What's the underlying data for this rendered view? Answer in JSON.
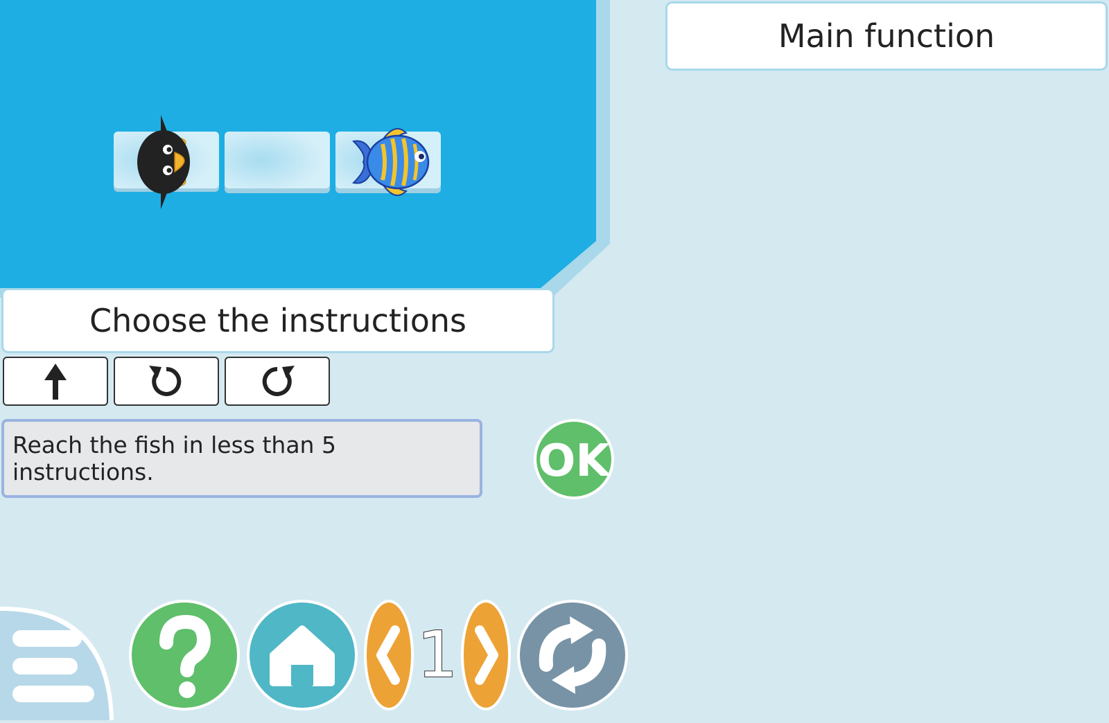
{
  "game": {
    "tiles": [
      "penguin",
      "empty",
      "fish"
    ],
    "colors": {
      "water": "#1eaee4",
      "ice": "#cfeef9",
      "accent": "#f0a02e",
      "ok": "#5fbf6a"
    }
  },
  "toolbox": {
    "title": "Choose the instructions",
    "instructions": [
      {
        "icon": "up-arrow-icon",
        "action": "forward"
      },
      {
        "icon": "rotate-left-icon",
        "action": "turn-left"
      },
      {
        "icon": "rotate-right-icon",
        "action": "turn-right"
      }
    ]
  },
  "objective": {
    "text": "Reach the fish in less than 5 instructions."
  },
  "ok_button": {
    "label": "OK"
  },
  "program": {
    "title": "Main function"
  },
  "nav": {
    "level": "1",
    "buttons": [
      "menu-icon",
      "help-icon",
      "home-icon",
      "prev-icon",
      "next-icon",
      "reset-icon"
    ]
  }
}
